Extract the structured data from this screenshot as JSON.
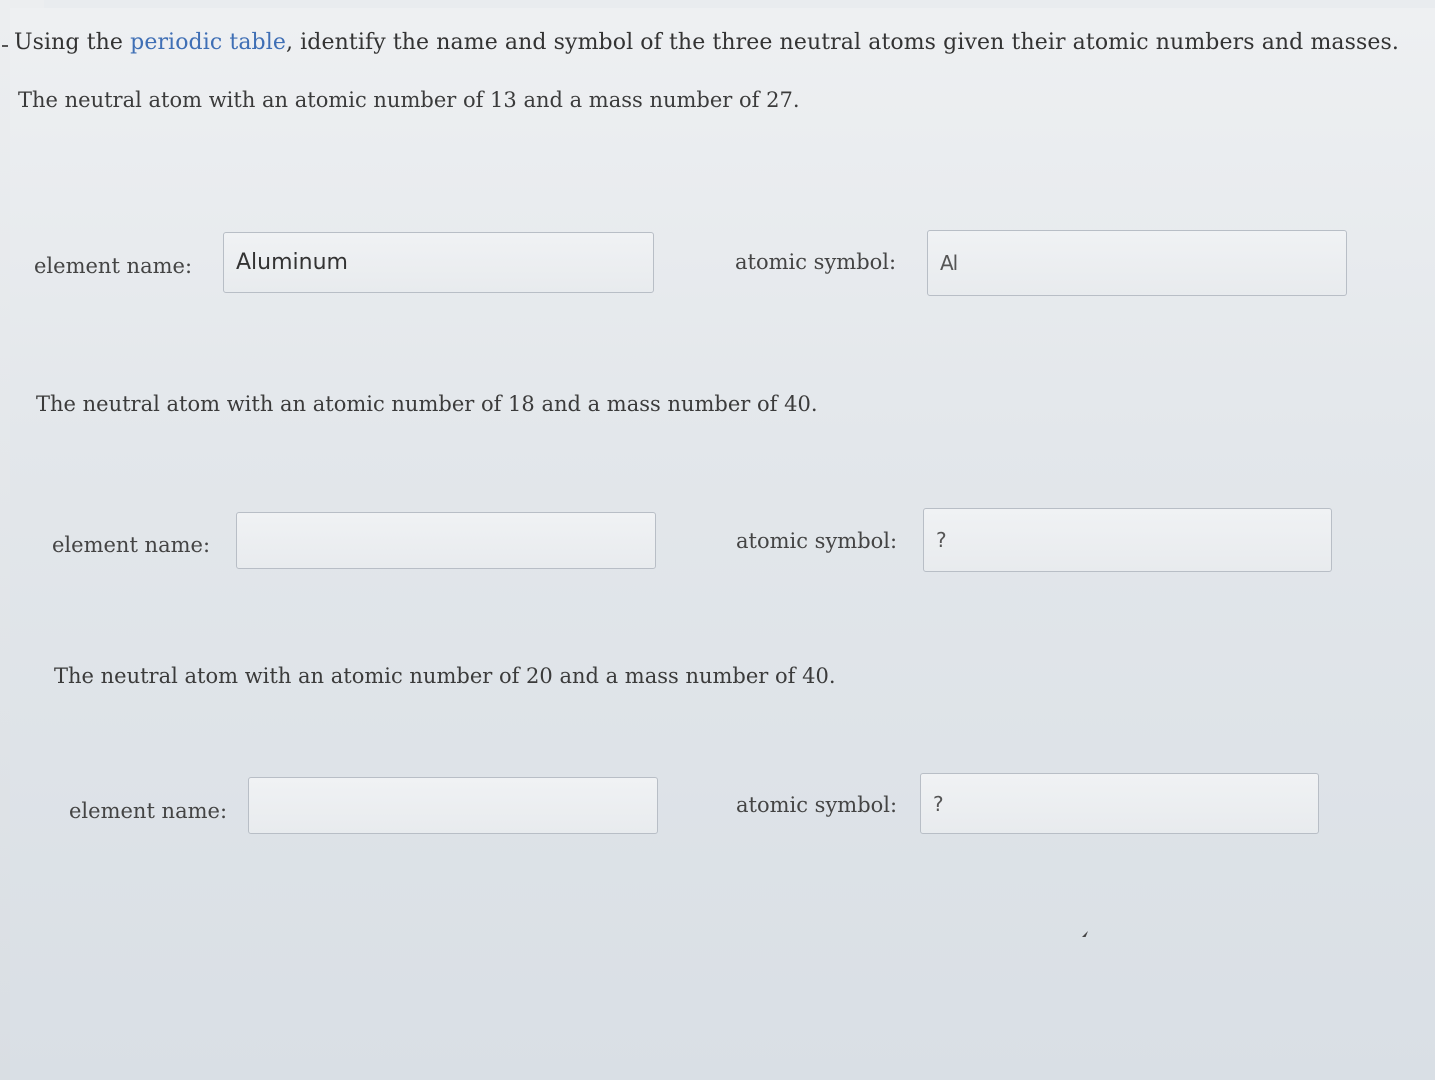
{
  "instructions": {
    "prefix": "Using the ",
    "link_text": "periodic table",
    "suffix": ", identify the name and symbol of the three neutral atoms given their atomic numbers and masses."
  },
  "questions": [
    {
      "prompt": "The neutral atom with an atomic number of 13 and a mass number of 27.",
      "name_label": "element name:",
      "name_value": "Aluminum",
      "symbol_label": "atomic symbol:",
      "symbol_value": "Al"
    },
    {
      "prompt": "The neutral atom with an atomic number of 18 and a mass number of 40.",
      "name_label": "element name:",
      "name_value": "",
      "symbol_label": "atomic symbol:",
      "symbol_value": "?"
    },
    {
      "prompt": "The neutral atom with an atomic number of 20 and a mass number of 40.",
      "name_label": "element name:",
      "name_value": "",
      "symbol_label": "atomic symbol:",
      "symbol_value": "?"
    }
  ],
  "colors": {
    "link": "#3f6fb5",
    "text": "#3a3a3a",
    "field_border": "#b8bec6"
  }
}
